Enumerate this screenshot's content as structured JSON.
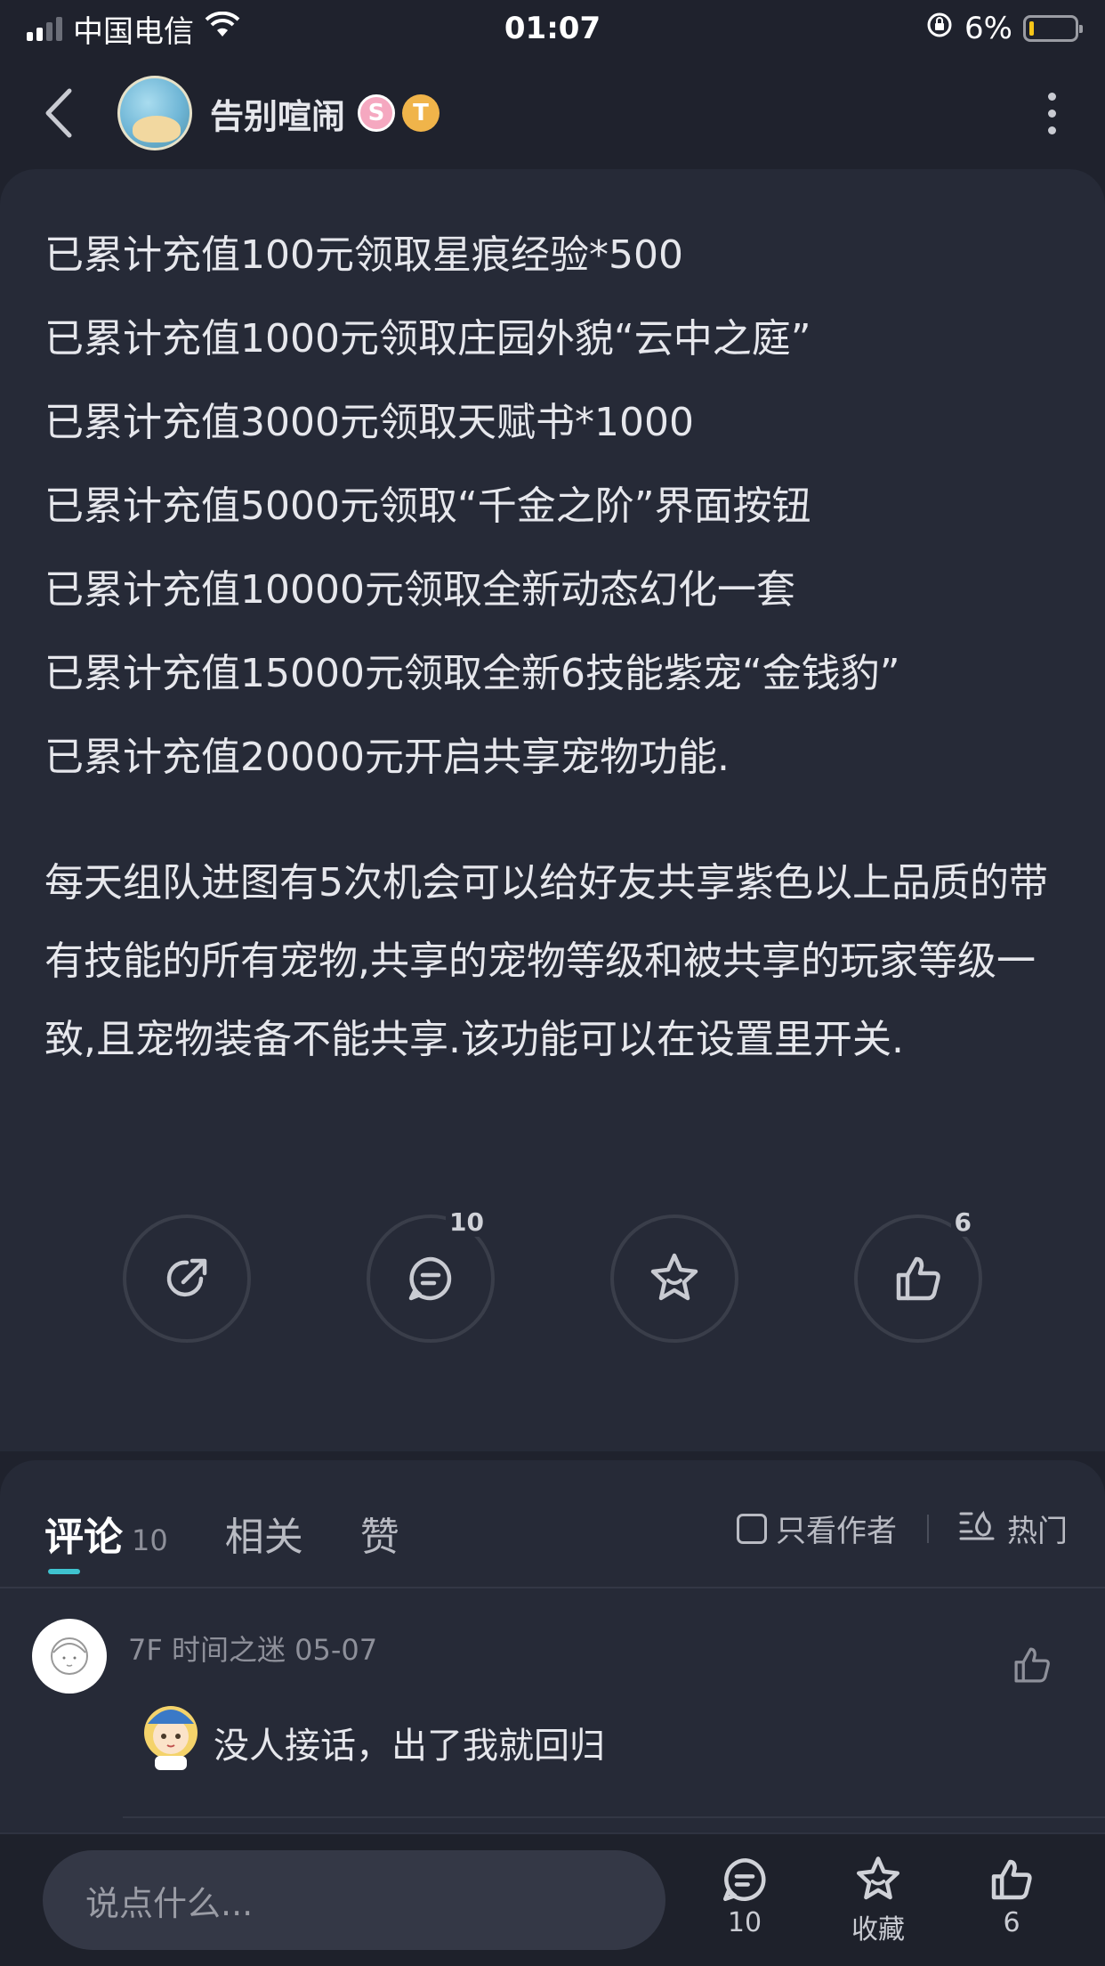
{
  "status_bar": {
    "carrier": "中国电信",
    "time": "01:07",
    "battery": "6%"
  },
  "header": {
    "username": "告别喧闹",
    "badge_s": "S",
    "badge_t": "T"
  },
  "post": {
    "lines": [
      "已累计充值100元领取星痕经验*500",
      "已累计充值1000元领取庄园外貌“云中之庭”",
      "已累计充值3000元领取天赋书*1000",
      "已累计充值5000元领取“千金之阶”界面按钮",
      "已累计充值10000元领取全新动态幻化一套",
      "已累计充值15000元领取全新6技能紫宠“金钱豹”",
      "已累计充值20000元开启共享宠物功能."
    ],
    "paragraph": "每天组队进图有5次机会可以给好友共享紫色以上品质的带有技能的所有宠物,共享的宠物等级和被共享的玩家等级一致,且宠物装备不能共享.该功能可以在设置里开关."
  },
  "actions": {
    "comment_count": "10",
    "like_count": "6"
  },
  "comments_section": {
    "tabs": [
      {
        "label": "评论",
        "count": "10"
      },
      {
        "label": "相关"
      },
      {
        "label": "赞"
      }
    ],
    "filter_author": "只看作者",
    "filter_hot": "热门",
    "items": [
      {
        "floor": "7F",
        "user": "时间之迷",
        "date": "05-07",
        "text": "没人接话，出了我就回归"
      }
    ]
  },
  "bottom_bar": {
    "input_placeholder": "说点什么...",
    "comment_count": "10",
    "favorite_label": "收藏",
    "like_count": "6"
  }
}
